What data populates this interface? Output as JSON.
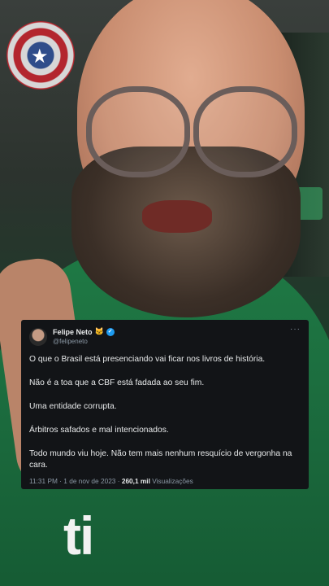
{
  "tweet": {
    "author_name": "Felipe Neto",
    "author_emoji": "🐱",
    "handle": "@felipeneto",
    "more": "···",
    "paragraphs": [
      "O que o Brasil está presenciando vai ficar nos livros de história.",
      "Não é a toa que a CBF está fadada ao seu fim.",
      "Uma entidade corrupta.",
      "Árbitros safados e mal intencionados.",
      "Todo mundo viu hoje. Não tem mais nenhum resquício de vergonha na cara."
    ],
    "time": "11:31 PM",
    "date": "1 de nov de 2023",
    "separator": "·",
    "views_count": "260,1 mil",
    "views_label": "Visualizações"
  },
  "background": {
    "shirt_text": "ti"
  },
  "colors": {
    "tweet_bg": "#121417",
    "verified": "#1d9bf0",
    "shirt": "#1b6a3d"
  }
}
